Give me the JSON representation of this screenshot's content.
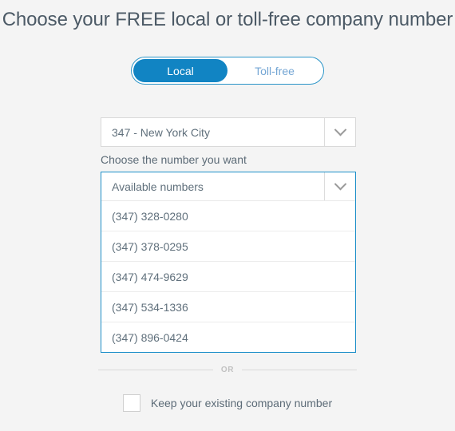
{
  "page": {
    "title": "Choose your FREE local or toll-free company number",
    "background_color": "#f4f4f4"
  },
  "number_type_toggle": {
    "active_color": "#1184c3",
    "border_color": "#2b95c8",
    "inactive_text_color": "#74a6d4",
    "selected": "Local",
    "options": [
      {
        "label": "Local",
        "state": "active"
      },
      {
        "label": "Toll-free",
        "state": "inactive"
      }
    ]
  },
  "area_code_select": {
    "value": "347 - New York City",
    "icon": "chevron-down-icon",
    "border_color": "#d9d9d9"
  },
  "number_picker": {
    "label": "Choose the number you want",
    "select_value": "Available numbers",
    "icon": "chevron-down-icon",
    "open": true,
    "focus_border_color": "#1c8fc9",
    "available_numbers": [
      "(347) 328-0280",
      "(347) 378-0295",
      "(347) 474-9629",
      "(347) 534-1336",
      "(347) 896-0424"
    ]
  },
  "divider": {
    "text": "OR"
  },
  "keep_number": {
    "label": "Keep your existing company number",
    "checked": false
  }
}
